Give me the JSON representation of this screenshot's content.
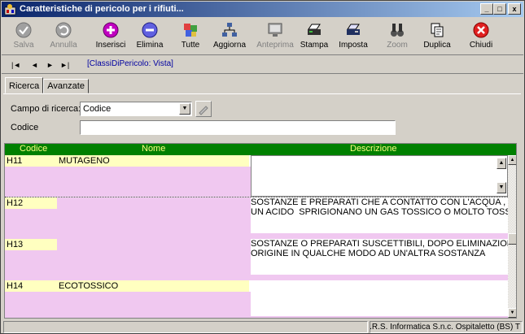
{
  "window": {
    "title": "Caratteristiche di pericolo per i rifiuti..."
  },
  "window_controls": [
    "_",
    "□",
    "x"
  ],
  "toolbar": {
    "salva": "Salva",
    "annulla": "Annulla",
    "inserisci": "Inserisci",
    "elimina": "Elimina",
    "tutte": "Tutte",
    "aggiorna": "Aggiorna",
    "anteprima": "Anteprima",
    "stampa": "Stampa",
    "imposta": "Imposta",
    "zoom": "Zoom",
    "duplica": "Duplica",
    "chiudi": "Chiudi"
  },
  "nav": {
    "first": "|◄",
    "prev": "◄",
    "next": "►",
    "last": "►|",
    "caption": "[ClassiDiPericolo: Vista]"
  },
  "tabs": {
    "ricerca": "Ricerca",
    "avanzate": "Avanzate"
  },
  "search": {
    "field_label": "Campo di ricerca:",
    "field_value": "Codice",
    "value_label": "Codice",
    "value": ""
  },
  "grid": {
    "columns": [
      "Codice",
      "Nome",
      "Descrizione"
    ],
    "rows": [
      {
        "code": "H11",
        "name": "MUTAGENO",
        "desc": ""
      },
      {
        "code": "H12",
        "name": "",
        "desc": "SOSTANZE E PREPARATI CHE A CONTATTO CON L'ACQUA , L'ARIAO\nUN ACIDO  SPRIGIONANO UN GAS TOSSICO O MOLTO TOSSICO"
      },
      {
        "code": "H13",
        "name": "",
        "desc": "SOSTANZE O PREPARATI SUSCETTIBILI, DOPO ELIMINAZIONE,DI\nORIGINE IN QUALCHE MODO AD UN'ALTRA SOSTANZA"
      },
      {
        "code": "H14",
        "name": "ECOTOSSICO",
        "desc": ""
      }
    ]
  },
  "status": {
    "company": "S.E.R.S. Informatica S.n.c. Ospitaletto (BS) T"
  },
  "colors": {
    "grid_header": "#008000",
    "header_text": "#ffff80",
    "row_pink": "#f0c8f0",
    "row_yellow": "#ffffc0"
  }
}
